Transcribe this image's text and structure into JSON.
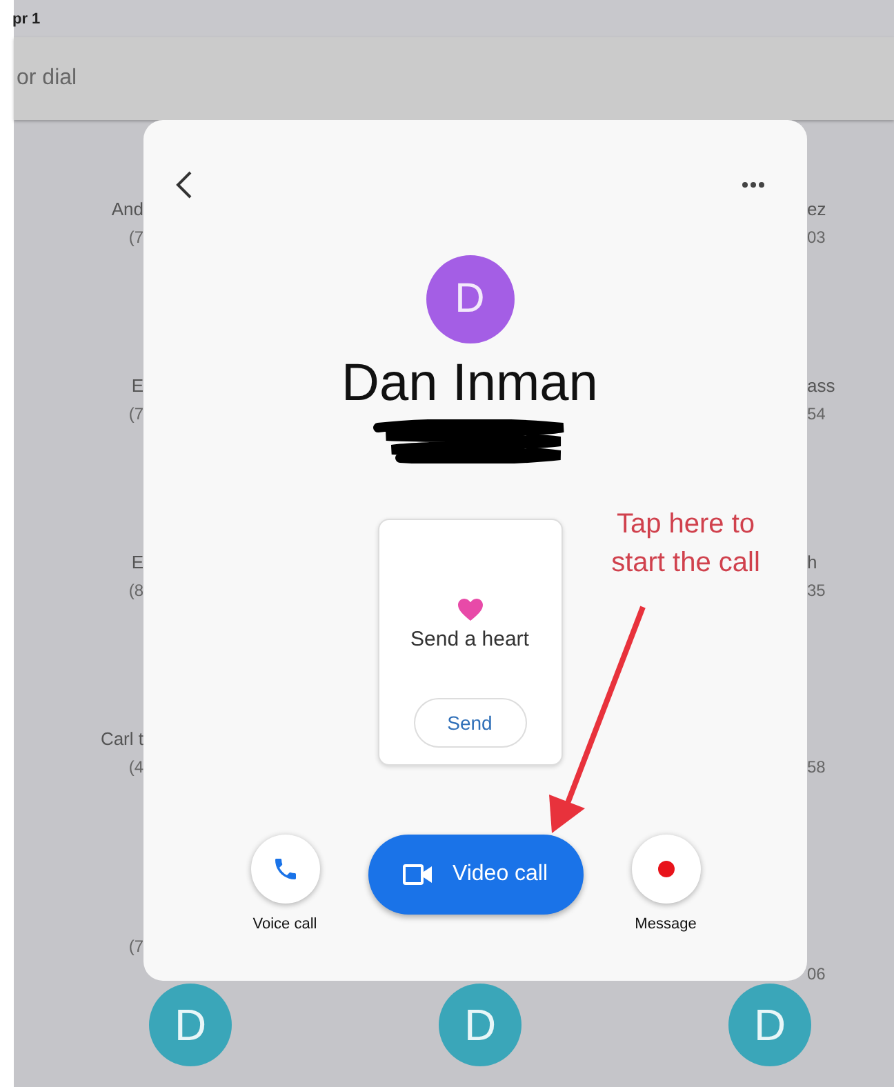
{
  "status_bar": {
    "text": "pr 1"
  },
  "search": {
    "placeholder": "or dial"
  },
  "background_contacts": [
    {
      "left": {
        "name": "And",
        "phone": "(7"
      },
      "right": {
        "name": "ez",
        "phone": "03"
      }
    },
    {
      "left": {
        "name": "E",
        "phone": "(7"
      },
      "right": {
        "name": "ass",
        "phone": "54"
      }
    },
    {
      "left": {
        "name": "E",
        "phone": "(8"
      },
      "right": {
        "name": "h",
        "phone": "35"
      }
    },
    {
      "left": {
        "name": "Carl t",
        "phone": "(4"
      },
      "right": {
        "phone": "58"
      }
    },
    {
      "left": {
        "phone": "(7"
      },
      "right": {
        "phone": "06"
      }
    }
  ],
  "background_avatars": [
    {
      "letter": "D",
      "color": "#3aa6b9"
    },
    {
      "letter": "D",
      "color": "#3aa6b9"
    },
    {
      "letter": "D",
      "color": "#3aa6b9"
    }
  ],
  "contact_dialog": {
    "avatar": {
      "letter": "D",
      "color": "#a45ee5"
    },
    "name": "Dan Inman",
    "phone_redacted": true,
    "heart_card": {
      "title": "Send a heart",
      "button": "Send"
    },
    "actions": [
      {
        "kind": "round",
        "label": "Voice call"
      },
      {
        "kind": "primary",
        "label": "Video call"
      },
      {
        "kind": "round",
        "label": "Message"
      }
    ]
  },
  "annotation": {
    "text": "Tap here to start the call"
  }
}
